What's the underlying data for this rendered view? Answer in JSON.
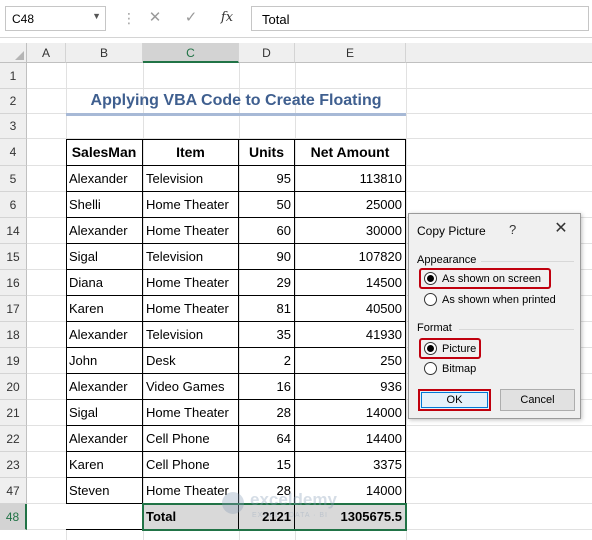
{
  "formula_bar": {
    "name_box": "C48",
    "cancel_glyph": "✕",
    "enter_glyph": "✓",
    "fx_glyph": "fx",
    "formula": "Total"
  },
  "columns": [
    "A",
    "B",
    "C",
    "D",
    "E"
  ],
  "rows": [
    "1",
    "2",
    "3",
    "4",
    "5",
    "6",
    "14",
    "15",
    "16",
    "17",
    "18",
    "19",
    "20",
    "21",
    "22",
    "23",
    "47",
    "48"
  ],
  "title": "Applying VBA Code to Create Floating",
  "table": {
    "headers": [
      "SalesMan",
      "Item",
      "Units",
      "Net Amount"
    ],
    "rows": [
      [
        "Alexander",
        "Television",
        "95",
        "113810"
      ],
      [
        "Shelli",
        "Home Theater",
        "50",
        "25000"
      ],
      [
        "Alexander",
        "Home Theater",
        "60",
        "30000"
      ],
      [
        "Sigal",
        "Television",
        "90",
        "107820"
      ],
      [
        "Diana",
        "Home Theater",
        "29",
        "14500"
      ],
      [
        "Karen",
        "Home Theater",
        "81",
        "40500"
      ],
      [
        "Alexander",
        "Television",
        "35",
        "41930"
      ],
      [
        "John",
        "Desk",
        "2",
        "250"
      ],
      [
        "Alexander",
        "Video Games",
        "16",
        "936"
      ],
      [
        "Sigal",
        "Home Theater",
        "28",
        "14000"
      ],
      [
        "Alexander",
        "Cell Phone",
        "64",
        "14400"
      ],
      [
        "Karen",
        "Cell Phone",
        "15",
        "3375"
      ],
      [
        "Steven",
        "Home Theater",
        "28",
        "14000"
      ]
    ],
    "total": [
      "",
      "Total",
      "2121",
      "1305675.5"
    ]
  },
  "watermark": {
    "name": "exceldemy",
    "tagline": "EXCEL · DATA · BI"
  },
  "dialog": {
    "title": "Copy Picture",
    "help": "?",
    "close": "✕",
    "appearance_label": "Appearance",
    "appearance_options": [
      "As shown on screen",
      "As shown when printed"
    ],
    "format_label": "Format",
    "format_options": [
      "Picture",
      "Bitmap"
    ],
    "ok": "OK",
    "cancel": "Cancel"
  },
  "colors": {
    "excel_green": "#217346",
    "highlight_red": "#c0000e",
    "title_blue": "#3f5f8f"
  }
}
